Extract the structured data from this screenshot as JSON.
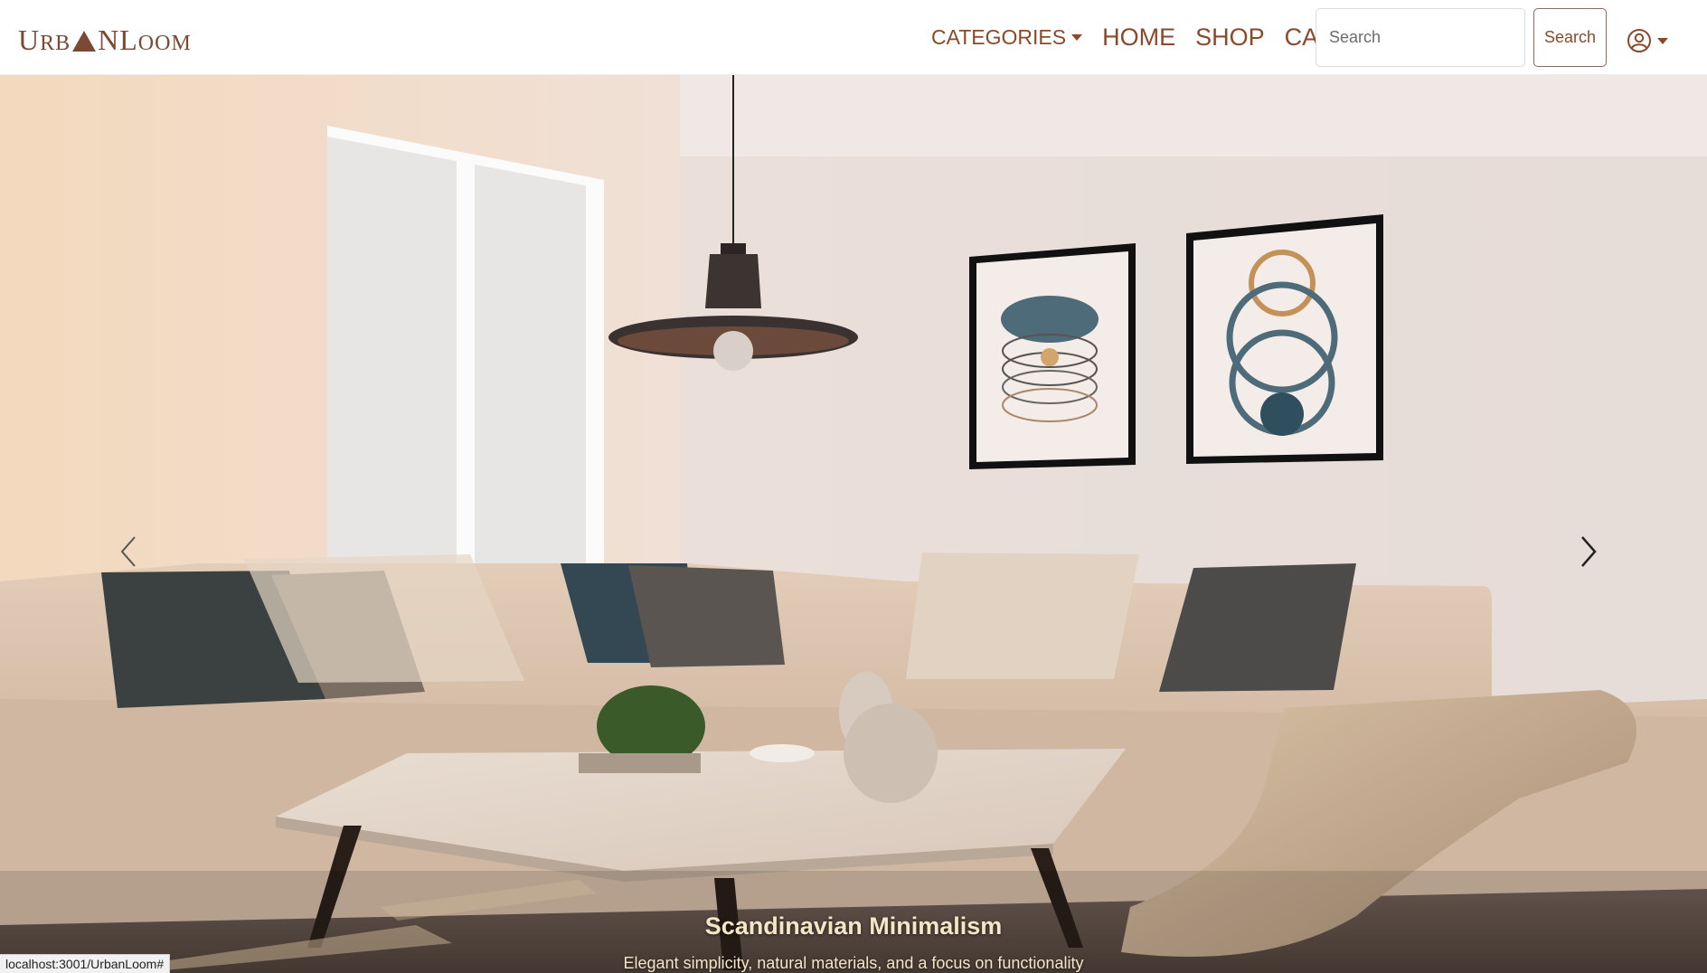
{
  "brand": {
    "part1": "U",
    "part1_sc": "RB",
    "part2": "N",
    "part3": "L",
    "part3_sc": "OOM",
    "full_name": "UrbanLoom"
  },
  "nav": {
    "categories_label": "CATEGORIES",
    "home_label": "HOME",
    "shop_label": "SHOP",
    "cart_label": "CART"
  },
  "search": {
    "placeholder": "Search",
    "button_label": "Search"
  },
  "user_menu": {
    "icon": "user-circle-icon"
  },
  "carousel": {
    "slide_title": "Scandinavian Minimalism",
    "slide_text": "Elegant simplicity, natural materials, and a focus on functionality",
    "prev_icon": "chevron-left-icon",
    "next_icon": "chevron-right-icon"
  },
  "status_bar": {
    "url": "localhost:3001/UrbanLoom#"
  },
  "colors": {
    "brand": "#7a4a35",
    "nav_link": "#8a4a2a",
    "caption": "#f6e6c8"
  }
}
